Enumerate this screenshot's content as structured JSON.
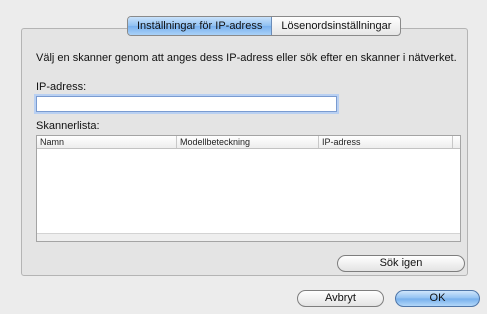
{
  "tabs": [
    {
      "label": "Inställningar för IP-adress",
      "active": true
    },
    {
      "label": "Lösenordsinställningar",
      "active": false
    }
  ],
  "instruction": "Välj en skanner genom att anges dess IP-adress eller sök efter en skanner i nätverket.",
  "ip_field": {
    "label": "IP-adress:",
    "value": ""
  },
  "scanner_list": {
    "label": "Skannerlista:",
    "columns": [
      "Namn",
      "Modellbeteckning",
      "IP-adress",
      ""
    ],
    "rows": []
  },
  "buttons": {
    "search_again": "Sök igen",
    "cancel": "Avbryt",
    "ok": "OK"
  },
  "colors": {
    "accent": "#8fc0f2",
    "focus_ring": "#b9d0f2",
    "window_bg": "#ececec"
  }
}
